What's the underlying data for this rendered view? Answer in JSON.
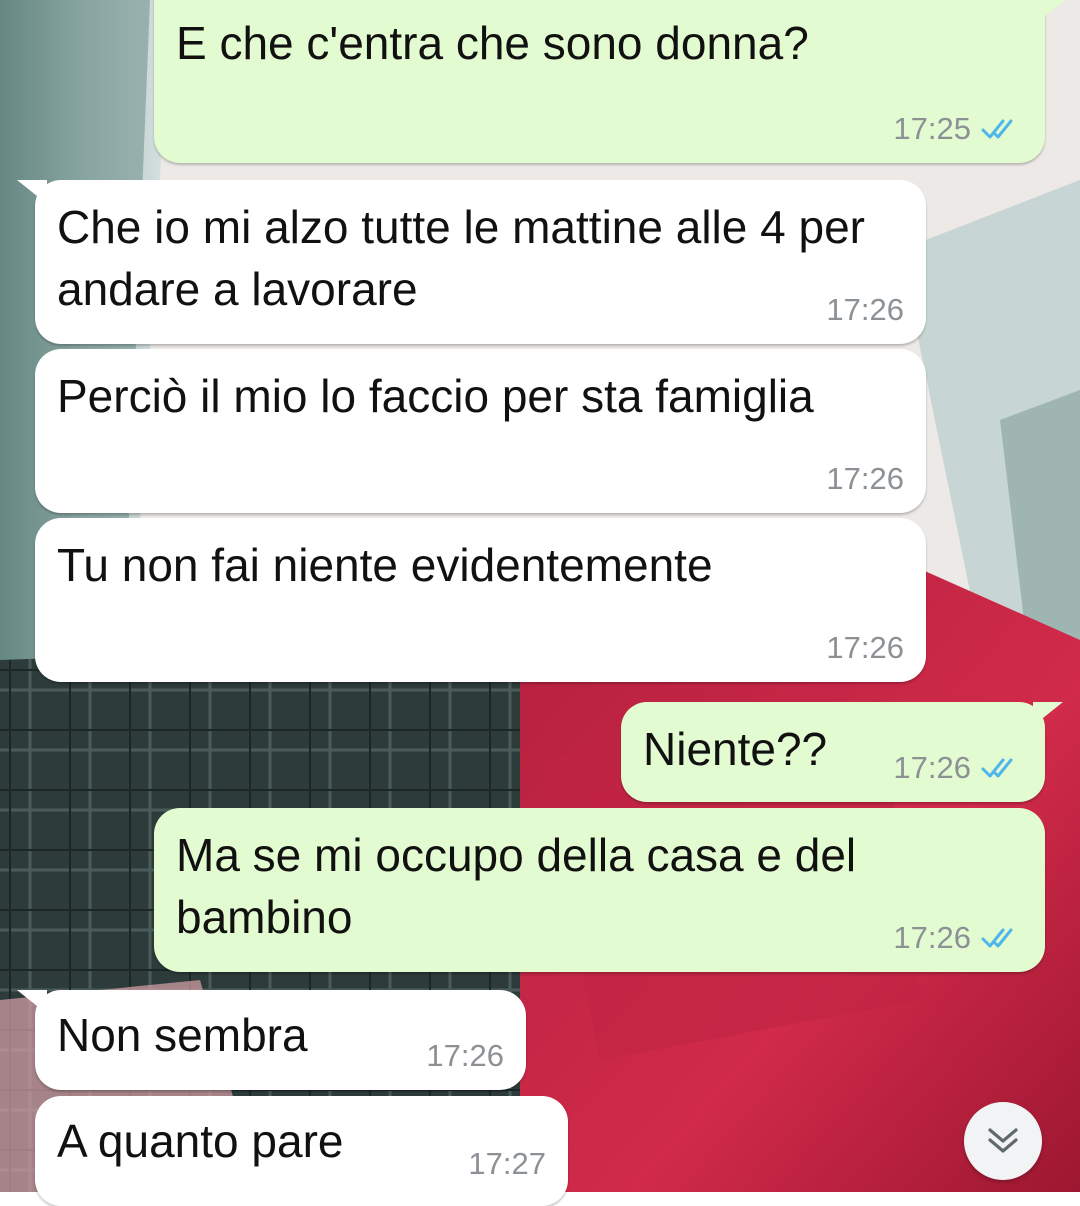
{
  "chat": {
    "messages": [
      {
        "direction": "out",
        "text": "E che c'entra che sono donna?",
        "time": "17:25",
        "status": "read"
      },
      {
        "direction": "in",
        "text": "Che io mi alzo tutte le mattine alle 4 per andare a lavorare",
        "time": "17:26"
      },
      {
        "direction": "in",
        "text": "Perciò il mio lo faccio per sta famiglia",
        "time": "17:26"
      },
      {
        "direction": "in",
        "text": "Tu non fai niente evidentemente",
        "time": "17:26"
      },
      {
        "direction": "out",
        "text": "Niente??",
        "time": "17:26",
        "status": "read"
      },
      {
        "direction": "out",
        "text": "Ma se mi occupo della casa e del bambino",
        "time": "17:26",
        "status": "read"
      },
      {
        "direction": "in",
        "text": "Non sembra",
        "time": "17:26"
      },
      {
        "direction": "in",
        "text": "A quanto pare",
        "time": "17:27"
      }
    ]
  },
  "icons": {
    "read_receipt": "double-check-icon",
    "scroll_down": "chevron-double-down-icon"
  },
  "colors": {
    "incoming_bubble": "#ffffff",
    "outgoing_bubble": "#e2fbd0",
    "read_tick": "#4fb6ec",
    "timestamp": "#8c9196"
  }
}
